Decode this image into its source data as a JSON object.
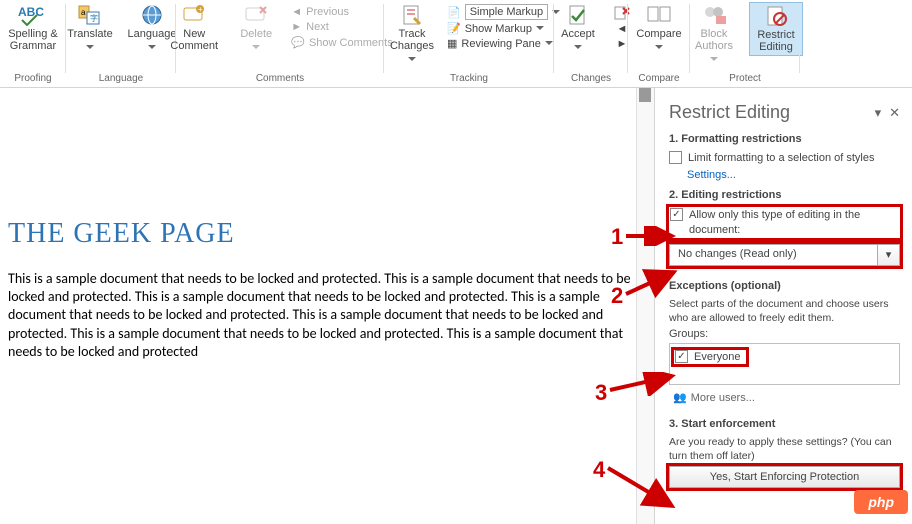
{
  "ribbon": {
    "proofing": {
      "spelling": "Spelling &\nGrammar",
      "label": "Proofing"
    },
    "language": {
      "translate": "Translate",
      "language": "Language",
      "label": "Language"
    },
    "comments": {
      "new": "New\nComment",
      "delete": "Delete",
      "previous": "Previous",
      "next": "Next",
      "show": "Show Comments",
      "label": "Comments"
    },
    "tracking": {
      "track": "Track\nChanges",
      "simple": "Simple Markup",
      "showMarkup": "Show Markup",
      "reviewing": "Reviewing Pane",
      "label": "Tracking"
    },
    "changes": {
      "accept": "Accept",
      "label": "Changes"
    },
    "compare": {
      "compare": "Compare",
      "label": "Compare"
    },
    "protect": {
      "block": "Block\nAuthors",
      "restrict": "Restrict\nEditing",
      "label": "Protect"
    }
  },
  "document": {
    "title": "THE GEEK PAGE",
    "body": "This is a sample document that needs to be locked and protected. This is a sample document that needs to be locked and protected. This is a sample document that needs to be locked and protected. This is a sample document that needs to be locked and protected. This is a sample document that needs to be locked and protected. This is a sample document that needs to be locked and protected. This is a sample document that needs to be locked and protected"
  },
  "pane": {
    "title": "Restrict Editing",
    "sect1": "1. Formatting restrictions",
    "limitFormatting": "Limit formatting to a selection of styles",
    "settings": "Settings...",
    "sect2": "2. Editing restrictions",
    "allowOnly": "Allow only this type of editing in the document:",
    "noChanges": "No changes (Read only)",
    "exceptions": "Exceptions (optional)",
    "exceptDesc": "Select parts of the document and choose users who are allowed to freely edit them.",
    "groups": "Groups:",
    "everyone": "Everyone",
    "moreUsers": "More users...",
    "sect3": "3. Start enforcement",
    "readyDesc": "Are you ready to apply these settings? (You can turn them off later)",
    "enforceBtn": "Yes, Start Enforcing Protection"
  },
  "callouts": {
    "n1": "1",
    "n2": "2",
    "n3": "3",
    "n4": "4"
  },
  "badge": "php"
}
